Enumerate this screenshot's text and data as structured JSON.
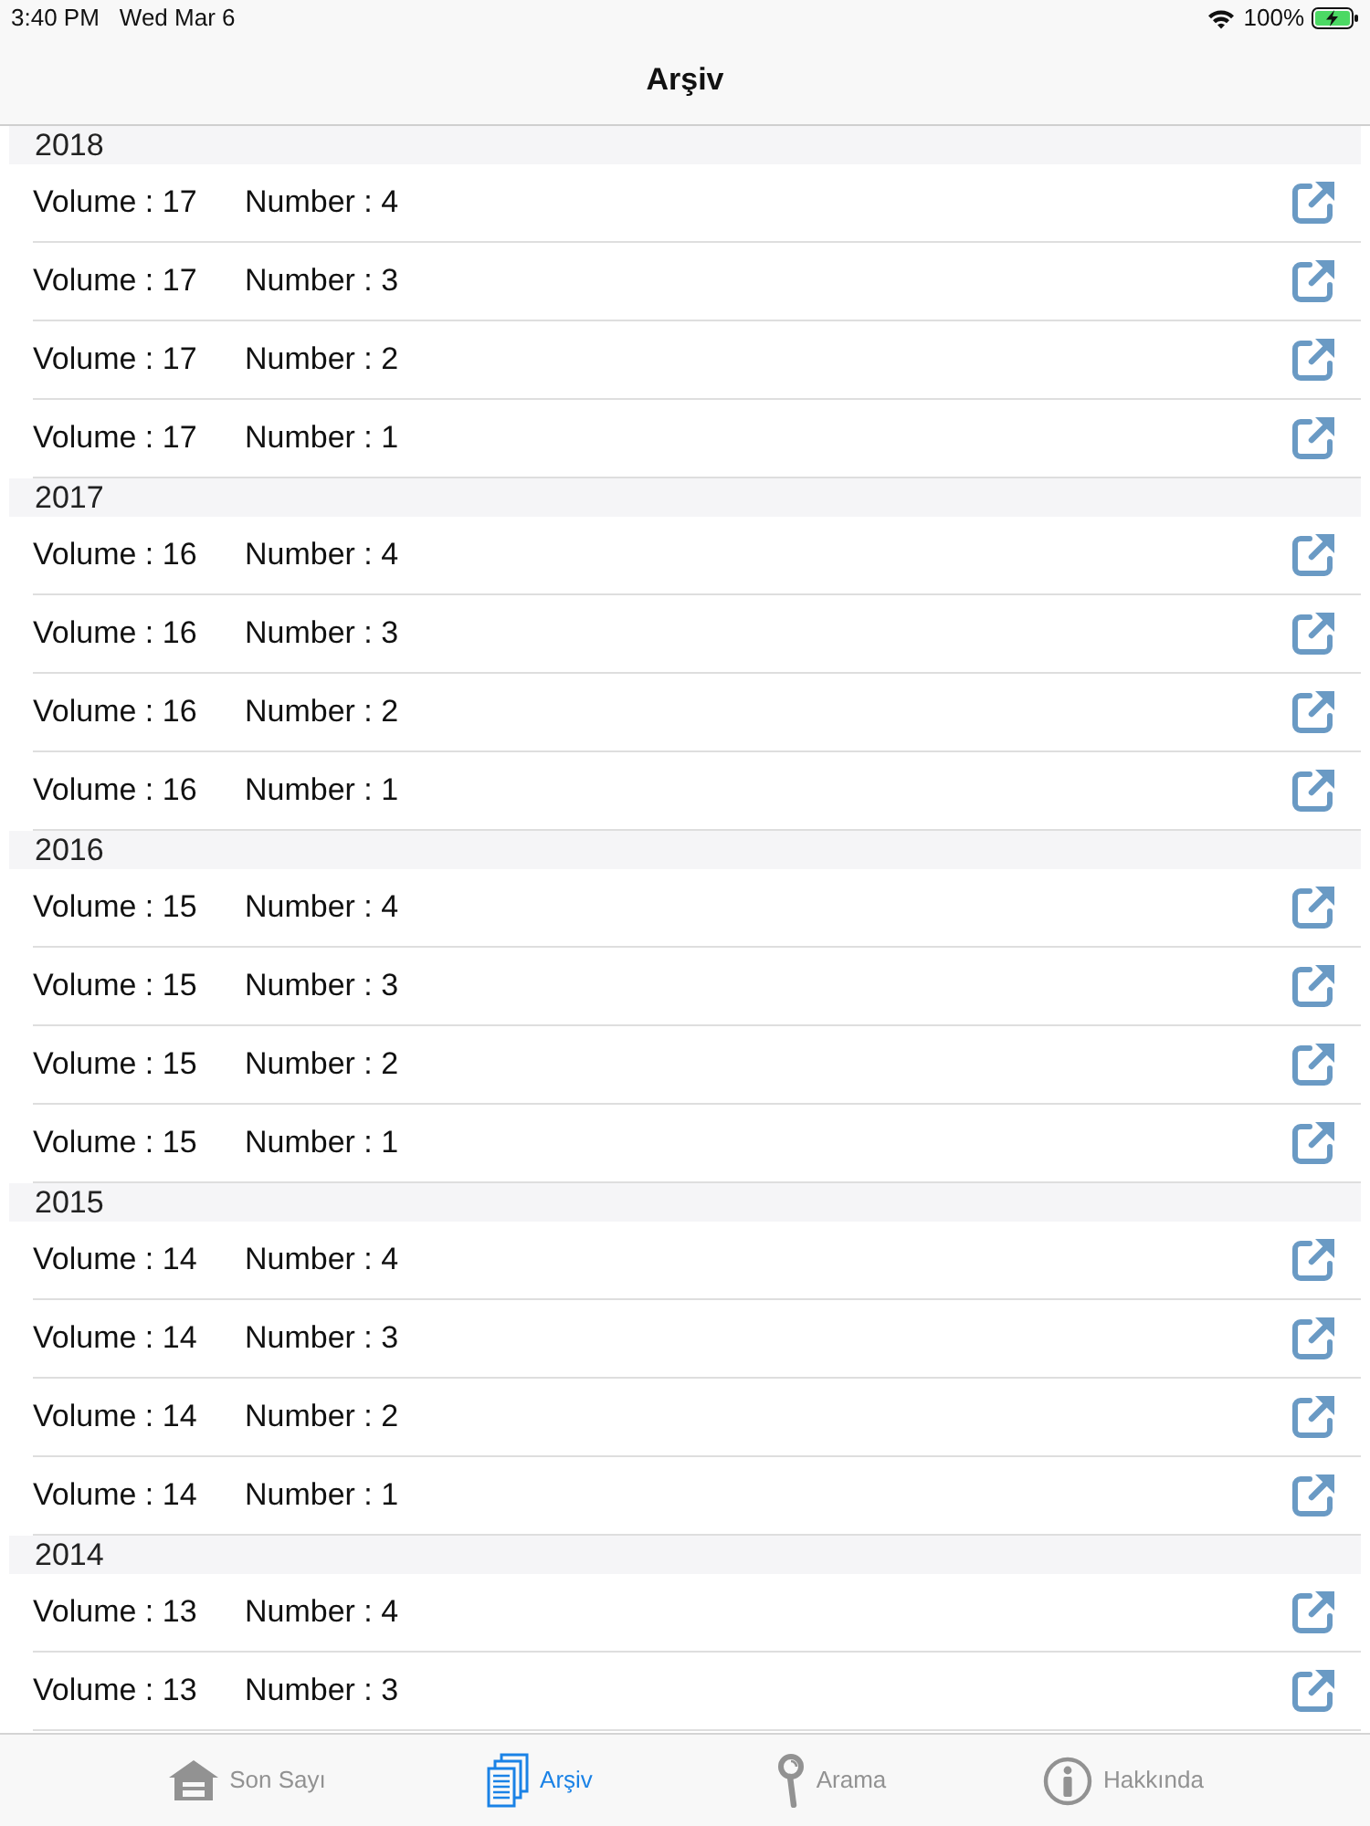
{
  "status_bar": {
    "time": "3:40 PM",
    "date": "Wed Mar 6",
    "battery": "100%"
  },
  "navigation_bar": {
    "title": "Arşiv"
  },
  "sections": [
    {
      "year": "2018",
      "rows": [
        {
          "volume": "Volume : 17",
          "number": "Number : 4"
        },
        {
          "volume": "Volume : 17",
          "number": "Number : 3"
        },
        {
          "volume": "Volume : 17",
          "number": "Number : 2"
        },
        {
          "volume": "Volume : 17",
          "number": "Number : 1"
        }
      ]
    },
    {
      "year": "2017",
      "rows": [
        {
          "volume": "Volume : 16",
          "number": "Number : 4"
        },
        {
          "volume": "Volume : 16",
          "number": "Number : 3"
        },
        {
          "volume": "Volume : 16",
          "number": "Number : 2"
        },
        {
          "volume": "Volume : 16",
          "number": "Number : 1"
        }
      ]
    },
    {
      "year": "2016",
      "rows": [
        {
          "volume": "Volume : 15",
          "number": "Number : 4"
        },
        {
          "volume": "Volume : 15",
          "number": "Number : 3"
        },
        {
          "volume": "Volume : 15",
          "number": "Number : 2"
        },
        {
          "volume": "Volume : 15",
          "number": "Number : 1"
        }
      ]
    },
    {
      "year": "2015",
      "rows": [
        {
          "volume": "Volume : 14",
          "number": "Number : 4"
        },
        {
          "volume": "Volume : 14",
          "number": "Number : 3"
        },
        {
          "volume": "Volume : 14",
          "number": "Number : 2"
        },
        {
          "volume": "Volume : 14",
          "number": "Number : 1"
        }
      ]
    },
    {
      "year": "2014",
      "rows": [
        {
          "volume": "Volume : 13",
          "number": "Number : 4"
        },
        {
          "volume": "Volume : 13",
          "number": "Number : 3"
        }
      ]
    }
  ],
  "tab_bar": {
    "tabs": [
      {
        "label": "Son Sayı",
        "selected": false
      },
      {
        "label": "Arşiv",
        "selected": true
      },
      {
        "label": "Arama",
        "selected": false
      },
      {
        "label": "Hakkında",
        "selected": false
      }
    ]
  }
}
